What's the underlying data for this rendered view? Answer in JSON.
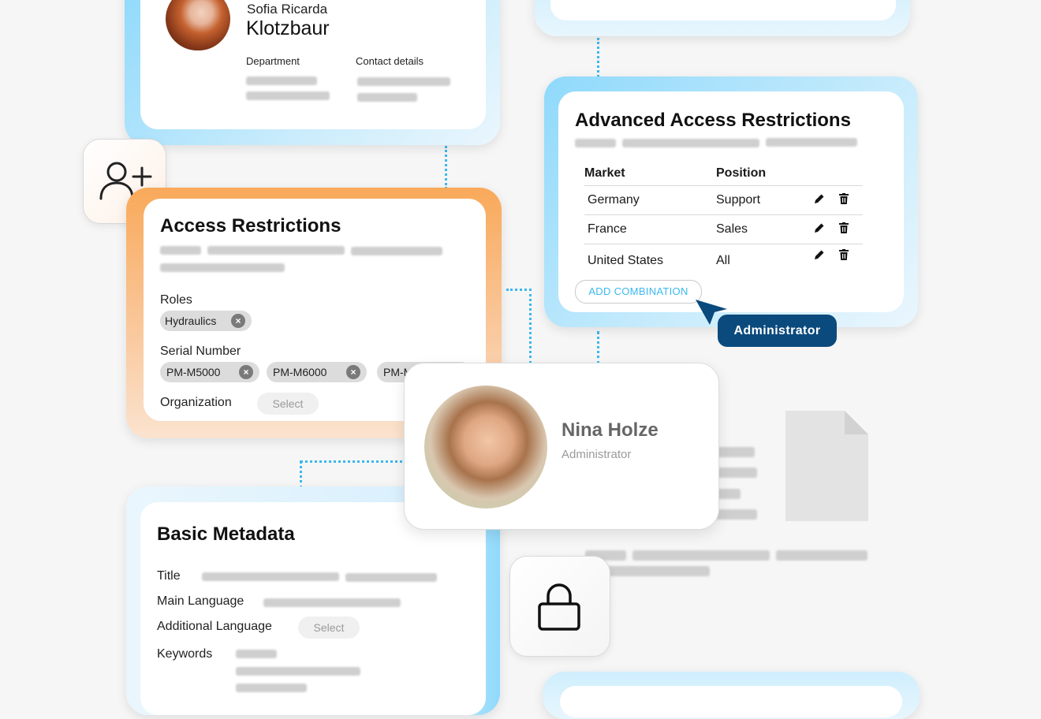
{
  "profile_card": {
    "first_name": "Sofia Ricarda",
    "last_name": "Klotzbaur",
    "department_label": "Department",
    "contact_label": "Contact details"
  },
  "access_restrictions": {
    "title": "Access Restrictions",
    "roles_label": "Roles",
    "roles": [
      "Hydraulics"
    ],
    "serial_label": "Serial Number",
    "serials": [
      "PM-M5000",
      "PM-M6000",
      "PM-M"
    ],
    "organization_label": "Organization",
    "organization_placeholder": "Select"
  },
  "advanced_access": {
    "title": "Advanced Access Restrictions",
    "columns": [
      "Market",
      "Position"
    ],
    "rows": [
      {
        "market": "Germany",
        "position": "Support"
      },
      {
        "market": "France",
        "position": "Sales"
      },
      {
        "market": "United States",
        "position": "All"
      }
    ],
    "add_button": "ADD COMBINATION"
  },
  "cursor_badge": "Administrator",
  "user_popup": {
    "name": "Nina Holze",
    "role": "Administrator"
  },
  "basic_metadata": {
    "title": "Basic Metadata",
    "fields": {
      "title": "Title",
      "main_language": "Main Language",
      "additional_language": "Additional Language",
      "additional_placeholder": "Select",
      "keywords": "Keywords"
    }
  },
  "icons": {
    "add_user": "add-user-icon",
    "lock": "lock-icon",
    "edit": "pencil-icon",
    "delete": "trash-icon",
    "remove": "close-icon",
    "document": "document-icon"
  },
  "colors": {
    "accent_blue": "#3bb8ee",
    "accent_orange": "#f9a95a",
    "badge_navy": "#0b4a7d"
  }
}
